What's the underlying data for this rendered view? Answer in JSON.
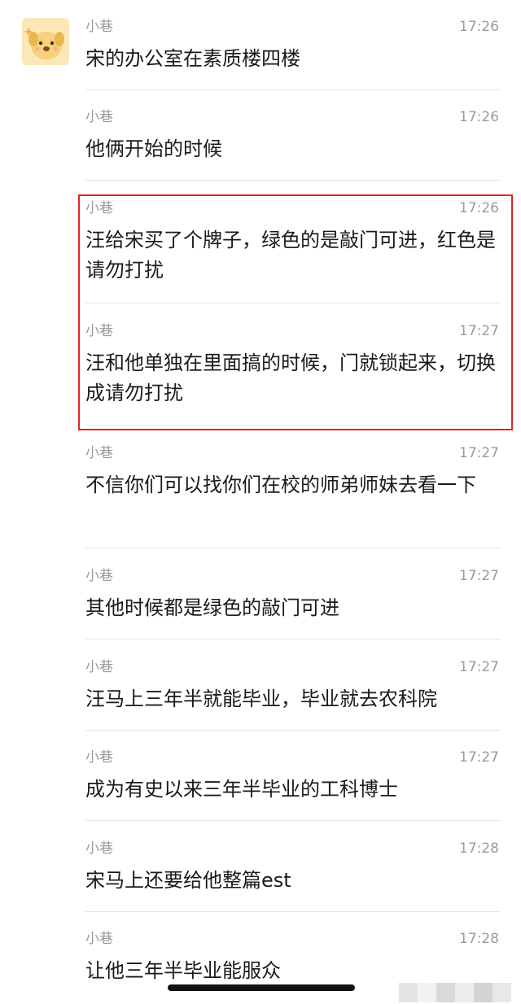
{
  "chat": {
    "sender_name": "小巷",
    "messages": [
      {
        "time": "17:26",
        "text": "宋的办公室在素质楼四楼"
      },
      {
        "time": "17:26",
        "text": "他俩开始的时候"
      },
      {
        "time": "17:26",
        "text": "汪给宋买了个牌子，绿色的是敲门可进，红色是请勿打扰"
      },
      {
        "time": "17:27",
        "text": "汪和他单独在里面搞的时候，门就锁起来，切换成请勿打扰"
      },
      {
        "time": "17:27",
        "text": "不信你们可以找你们在校的师弟师妹去看一下"
      },
      {
        "time": "17:27",
        "text": "其他时候都是绿色的敲门可进"
      },
      {
        "time": "17:27",
        "text": "汪马上三年半就能毕业，毕业就去农科院"
      },
      {
        "time": "17:27",
        "text": "成为有史以来三年半毕业的工科博士"
      },
      {
        "time": "17:28",
        "text": "宋马上还要给他整篇est"
      },
      {
        "time": "17:28",
        "text": "让他三年半毕业能服众"
      }
    ]
  },
  "colors": {
    "highlight": "#e02424",
    "meta_text": "#9a9a9a",
    "body_text": "#1a1a1a",
    "avatar_bg": "#fbe8b6"
  },
  "icons": {
    "avatar": "cartoon-dog-avatar-icon"
  }
}
